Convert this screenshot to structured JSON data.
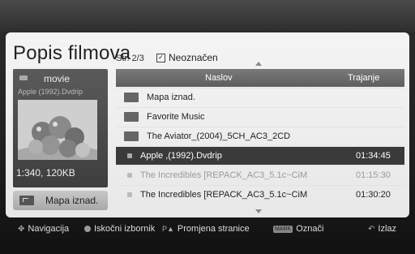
{
  "header": {
    "title": "Popis filmova",
    "page_indicator": "Str. 2/3",
    "unmarked_label": "Neoznačen"
  },
  "preview": {
    "folder_name": "movie",
    "file_name": "Apple (1992).Dvdrip",
    "info": "1:340, 120KB",
    "up_button": "Mapa iznad."
  },
  "list": {
    "col_title": "Naslov",
    "col_duration": "Trajanje",
    "rows": [
      {
        "name": "Mapa iznad.",
        "duration": "",
        "type": "folder"
      },
      {
        "name": "Favorite Music",
        "duration": "",
        "type": "folder"
      },
      {
        "name": "The Aviator_(2004)_5CH_AC3_2CD",
        "duration": "",
        "type": "folder"
      },
      {
        "name": "Apple ,(1992).Dvdrip",
        "duration": "01:34:45",
        "type": "file"
      },
      {
        "name": "The Incredibles [REPACK_AC3_5.1c~CiM",
        "duration": "01:15:30",
        "type": "file"
      },
      {
        "name": "The Incredibles [REPACK_AC3_5.1c~CiM",
        "duration": "01:30:20",
        "type": "file"
      }
    ]
  },
  "navbar": {
    "navigation": "Navigacija",
    "popup_menu": "Iskočni izbornik",
    "change_page": "Promjena stranice",
    "mark_key": "MARK",
    "mark": "Označi",
    "exit": "Izlaz"
  }
}
